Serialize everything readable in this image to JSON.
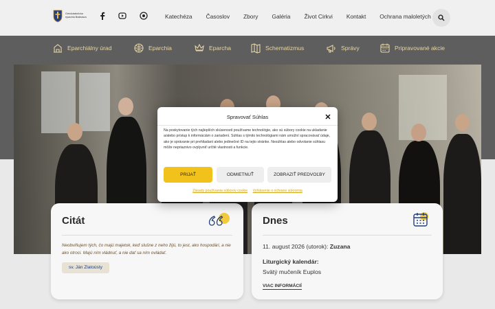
{
  "header": {
    "logo_text": "Gréckokatolícka eparchia Bratislava",
    "social": [
      {
        "icon": "facebook-icon"
      },
      {
        "icon": "video-icon"
      },
      {
        "icon": "instagram-icon"
      }
    ],
    "nav": [
      "Katechéza",
      "Časoslov",
      "Zbory",
      "Galéria",
      "Život Cirkvi",
      "Kontakt",
      "Ochrana maloletých"
    ],
    "search_icon": "search-icon"
  },
  "secondary_nav": [
    {
      "label": "Eparchiálny úrad",
      "icon": "building-icon"
    },
    {
      "label": "Eparchia",
      "icon": "globe-icon"
    },
    {
      "label": "Eparcha",
      "icon": "crown-icon"
    },
    {
      "label": "Schematizmus",
      "icon": "map-icon"
    },
    {
      "label": "Správy",
      "icon": "megaphone-icon"
    },
    {
      "label": "Pripravované akcie",
      "icon": "calendar-icon"
    }
  ],
  "quote_card": {
    "title": "Citát",
    "text": "Neobviňujem tých, čo majú majetok, keď slušne z neho žijú, to jest, ako hospodári, a nie ako otroci. Majú ním vládnuť, a nie dať sa ním ovládať.",
    "author": "sv. Ján Zlatoústy"
  },
  "today_card": {
    "title": "Dnes",
    "date": "11. august 2026 (utorok):",
    "name_day": "Zuzana",
    "liturgical_label": "Liturgický kalendár:",
    "liturgical_value": "Svätý mučeník Euplos",
    "more_link": "VIAC INFORMÁCIÍ"
  },
  "consent_modal": {
    "title": "Spravovať Súhlas",
    "body": "Na poskytovanie tých najlepších skúseností používame technológie, ako sú súbory cookie na ukladanie a/alebo prístup k informáciám o zariadení. Súhlas s týmito technológiami nám umožní spracovávať údaje, ako je správanie pri prehliadaní alebo jedinečné ID na tejto stránke. Nesúhlas alebo odvolanie súhlasu môže nepriaznivo ovplyvniť určité vlastnosti a funkcie.",
    "accept": "Prijať",
    "deny": "Odmietnuť",
    "preferences": "Zobraziť predvoľby",
    "link_cookie_policy": "Zásady používania súborov cookie",
    "link_privacy": "Vyhlásenie o ochrane súkromia"
  },
  "colors": {
    "accent_yellow": "#f1c21b",
    "nav_gold": "#e8d6a6",
    "link_blue": "#1f3c7a"
  }
}
